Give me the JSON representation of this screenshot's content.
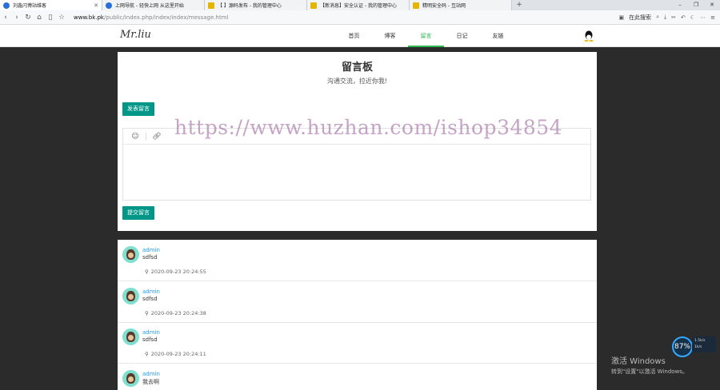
{
  "browser": {
    "tabs": [
      {
        "label": "刘鑫闪博站维客",
        "active": true
      },
      {
        "label": "上网导航 - 轻快上网 从这里开始",
        "active": false
      },
      {
        "label": "【 】源码发布 - 我的管理中心",
        "active": false
      },
      {
        "label": "【新消息】安全认证 - 我的管理中心",
        "active": false
      },
      {
        "label": "精明安全码 - 互站网",
        "active": false
      }
    ],
    "new_tab": "+",
    "url_host": "www.bk.pk",
    "url_path": "/public/index.php/index/index/message.html",
    "search_placeholder": "在此搜索",
    "window_controls": [
      "–",
      "❐",
      "✕"
    ]
  },
  "site": {
    "logo": "Mr.liu",
    "nav": [
      {
        "label": "首页",
        "active": false
      },
      {
        "label": "博客",
        "active": false
      },
      {
        "label": "留言",
        "active": true
      },
      {
        "label": "日记",
        "active": false
      },
      {
        "label": "友链",
        "active": false
      }
    ],
    "accent_color": "#2fb54f"
  },
  "board": {
    "title": "留言板",
    "subtitle": "沟通交流，拉近你我!",
    "post_button": "发表留言",
    "submit_button": "提交留言",
    "editor_tools": [
      "smile-icon",
      "link-icon"
    ]
  },
  "watermark": "https://www.huzhan.com/ishop34854",
  "comments": [
    {
      "author": "admin",
      "text": "sdfsd",
      "time": "2020-09-23 20:24:55"
    },
    {
      "author": "admin",
      "text": "sdfsd",
      "time": "2020-09-23 20:24:38"
    },
    {
      "author": "admin",
      "text": "sdfsd",
      "time": "2020-09-23 20:24:11"
    },
    {
      "author": "admin",
      "text": "我去啊",
      "time": ""
    }
  ],
  "system": {
    "perf_value": "87%",
    "perf_side": [
      "1.5k/s",
      "1k/s"
    ],
    "activate_title": "激活 Windows",
    "activate_sub": "转到\"设置\"以激活 Windows。"
  }
}
